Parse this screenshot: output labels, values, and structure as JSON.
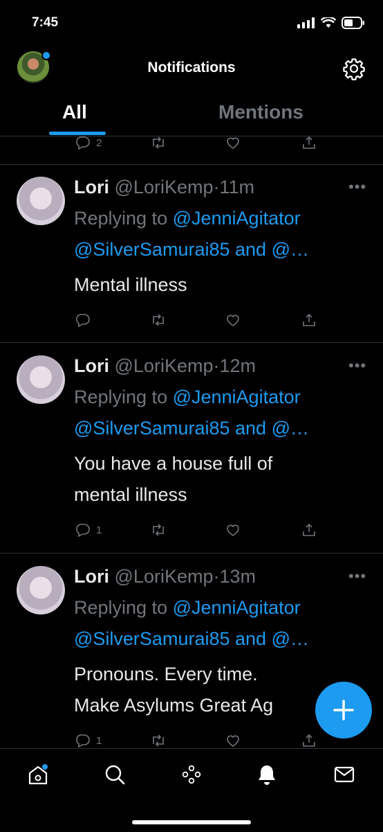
{
  "status_bar": {
    "time": "7:45"
  },
  "header": {
    "title": "Notifications"
  },
  "tabs": [
    {
      "label": "All",
      "active": true
    },
    {
      "label": "Mentions",
      "active": false
    }
  ],
  "prev_tweet": {
    "reply_count": "2"
  },
  "tweets": [
    {
      "name": "Lori",
      "handle": "@LoriKemp",
      "separator": "·",
      "time": "11m",
      "replying_prefix": "Replying to ",
      "replying_user1": "@JenniAgitator",
      "replying_user2": "@SilverSamurai85",
      "replying_and": " and ",
      "replying_more": "@…",
      "text_lines": [
        "Mental illness"
      ],
      "reply_count": ""
    },
    {
      "name": "Lori",
      "handle": "@LoriKemp",
      "separator": "·",
      "time": "12m",
      "replying_prefix": "Replying to ",
      "replying_user1": "@JenniAgitator",
      "replying_user2": "@SilverSamurai85",
      "replying_and": " and ",
      "replying_more": "@…",
      "text_lines": [
        "You have a house full of",
        "mental illness"
      ],
      "reply_count": "1"
    },
    {
      "name": "Lori",
      "handle": "@LoriKemp",
      "separator": "·",
      "time": "13m",
      "replying_prefix": "Replying to ",
      "replying_user1": "@JenniAgitator",
      "replying_user2": "@SilverSamurai85",
      "replying_and": " and ",
      "replying_more": "@…",
      "text_lines": [
        "Pronouns. Every time.",
        "Make Asylums Great Ag"
      ],
      "reply_count": "1"
    }
  ],
  "colors": {
    "accent": "#1d9bf0",
    "muted": "#71767b",
    "divider": "#2f3336"
  },
  "icons": [
    "signal-icon",
    "wifi-icon",
    "battery-icon",
    "gear-icon",
    "reply-icon",
    "retweet-icon",
    "like-icon",
    "share-icon",
    "more-icon",
    "compose-icon",
    "home-icon",
    "search-icon",
    "spaces-icon",
    "bell-icon",
    "mail-icon"
  ]
}
